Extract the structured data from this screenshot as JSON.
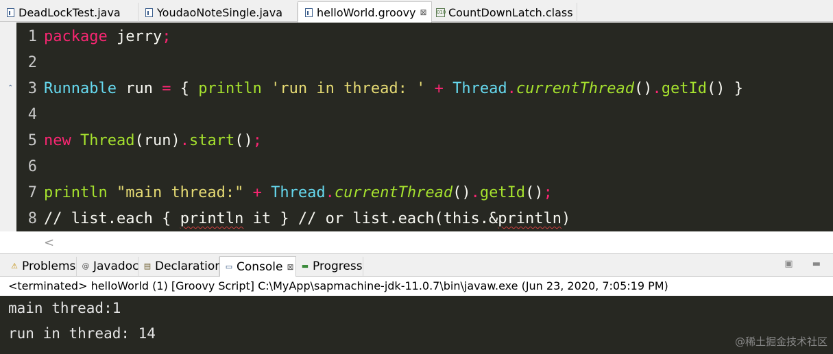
{
  "editor_tabs": [
    {
      "label": "DeadLockTest.java",
      "icon": "java-file-icon"
    },
    {
      "label": "YoudaoNoteSingle.java",
      "icon": "java-file-icon"
    },
    {
      "label": "helloWorld.groovy",
      "icon": "groovy-file-icon",
      "active": true,
      "close": "⊠"
    },
    {
      "label": "CountDownLatch.class",
      "icon": "class-file-icon",
      "icon_text": "010"
    }
  ],
  "code_lines": [
    {
      "num": "1",
      "tokens": [
        [
          "kw",
          "package"
        ],
        [
          "pl",
          " jerry"
        ],
        [
          "kw",
          ";"
        ]
      ]
    },
    {
      "num": "2",
      "tokens": []
    },
    {
      "num": "3",
      "tokens": [
        [
          "ty",
          "Runnable"
        ],
        [
          "pl",
          " run "
        ],
        [
          "op",
          "="
        ],
        [
          "pl",
          " { "
        ],
        [
          "fn",
          "println"
        ],
        [
          "pl",
          " "
        ],
        [
          "st",
          "'run in thread: '"
        ],
        [
          "pl",
          " "
        ],
        [
          "op",
          "+"
        ],
        [
          "pl",
          " "
        ],
        [
          "ty",
          "Thread"
        ],
        [
          "op",
          "."
        ],
        [
          "it",
          "currentThread"
        ],
        [
          "pl",
          "()"
        ],
        [
          "op",
          "."
        ],
        [
          "fn",
          "getId"
        ],
        [
          "pl",
          "() }"
        ]
      ]
    },
    {
      "num": "4",
      "tokens": []
    },
    {
      "num": "5",
      "tokens": [
        [
          "kw",
          "new"
        ],
        [
          "pl",
          " "
        ],
        [
          "fn",
          "Thread"
        ],
        [
          "pl",
          "(run)"
        ],
        [
          "op",
          "."
        ],
        [
          "fn",
          "start"
        ],
        [
          "pl",
          "()"
        ],
        [
          "kw",
          ";"
        ]
      ]
    },
    {
      "num": "6",
      "tokens": []
    },
    {
      "num": "7",
      "tokens": [
        [
          "fn",
          "println"
        ],
        [
          "pl",
          " "
        ],
        [
          "st",
          "\"main thread:\""
        ],
        [
          "pl",
          " "
        ],
        [
          "op",
          "+"
        ],
        [
          "pl",
          " "
        ],
        [
          "ty",
          "Thread"
        ],
        [
          "op",
          "."
        ],
        [
          "it",
          "currentThread"
        ],
        [
          "pl",
          "()"
        ],
        [
          "op",
          "."
        ],
        [
          "fn",
          "getId"
        ],
        [
          "pl",
          "()"
        ],
        [
          "kw",
          ";"
        ]
      ]
    },
    {
      "num": "8",
      "tokens": [
        [
          "cm",
          "// list.each { "
        ],
        [
          "sp",
          "println"
        ],
        [
          "cm",
          " it } // or list.each(this.&"
        ],
        [
          "sp",
          "println"
        ],
        [
          "cm",
          ")"
        ]
      ]
    }
  ],
  "scroll_left_label": "<",
  "panel_tabs": [
    {
      "label": "Problems",
      "icon": "problems-icon",
      "glyph": "⚠"
    },
    {
      "label": "Javadoc",
      "icon": "javadoc-icon",
      "glyph": "@"
    },
    {
      "label": "Declaration",
      "icon": "declaration-icon",
      "glyph": "▤"
    },
    {
      "label": "Console",
      "icon": "console-icon",
      "glyph": "▭",
      "active": true,
      "close": "⊠"
    },
    {
      "label": "Progress",
      "icon": "progress-icon",
      "glyph": "▬"
    }
  ],
  "panel_controls": "▣ ▬",
  "status_line": "<terminated> helloWorld (1) [Groovy Script] C:\\MyApp\\sapmachine-jdk-11.0.7\\bin\\javaw.exe (Jun 23, 2020, 7:05:19 PM)",
  "console_output": [
    "main thread:1",
    "run in thread: 14"
  ],
  "watermark": "@稀土掘金技术社区",
  "colors": {
    "editor_bg": "#272822",
    "keyword": "#f92672",
    "type": "#66d9ef",
    "function": "#a6e22e",
    "string": "#e6db74",
    "plain": "#f8f8f2"
  }
}
